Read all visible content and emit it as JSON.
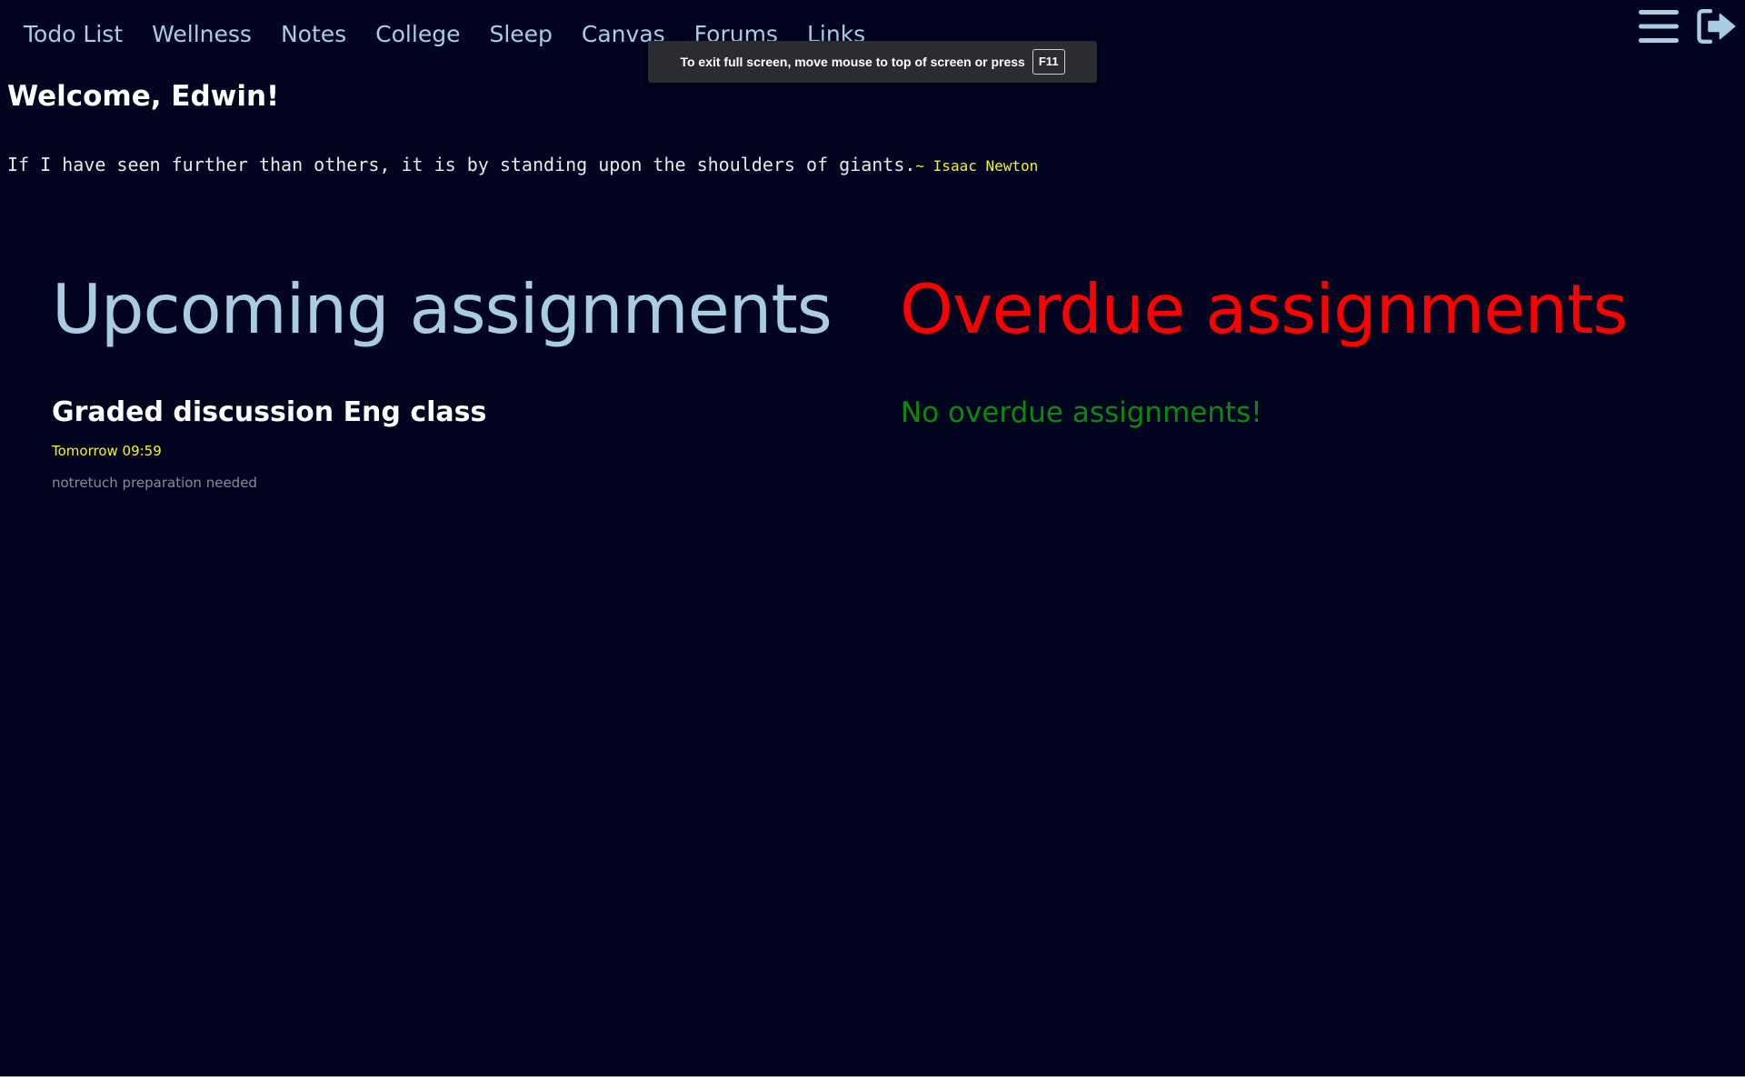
{
  "nav": {
    "items": [
      {
        "label": "Todo List"
      },
      {
        "label": "Wellness"
      },
      {
        "label": "Notes"
      },
      {
        "label": "College"
      },
      {
        "label": "Sleep"
      },
      {
        "label": "Canvas"
      },
      {
        "label": "Forums"
      },
      {
        "label": "Links"
      }
    ],
    "icons": [
      "hamburger-menu-icon",
      "logout-icon"
    ]
  },
  "fullscreen_toast": {
    "text": "To exit full screen, move mouse to top of screen or press",
    "key": "F11"
  },
  "welcome": "Welcome, Edwin!",
  "quote": {
    "text": "If I have seen further than others, it is by standing upon the shoulders of giants.",
    "author": "~ Isaac Newton"
  },
  "upcoming": {
    "heading": "Upcoming assignments",
    "assignments": [
      {
        "title": "Graded discussion Eng class",
        "due": "Tomorrow 09:59",
        "note": "notretuch preparation needed"
      }
    ]
  },
  "overdue": {
    "heading": "Overdue assignments",
    "empty_message": "No overdue assignments!"
  },
  "colors": {
    "background": "#020420",
    "nav_text": "#a8cde3",
    "overdue_heading": "#ff0000",
    "empty_message": "#0a8a0a",
    "due_date": "#f5f51a"
  }
}
